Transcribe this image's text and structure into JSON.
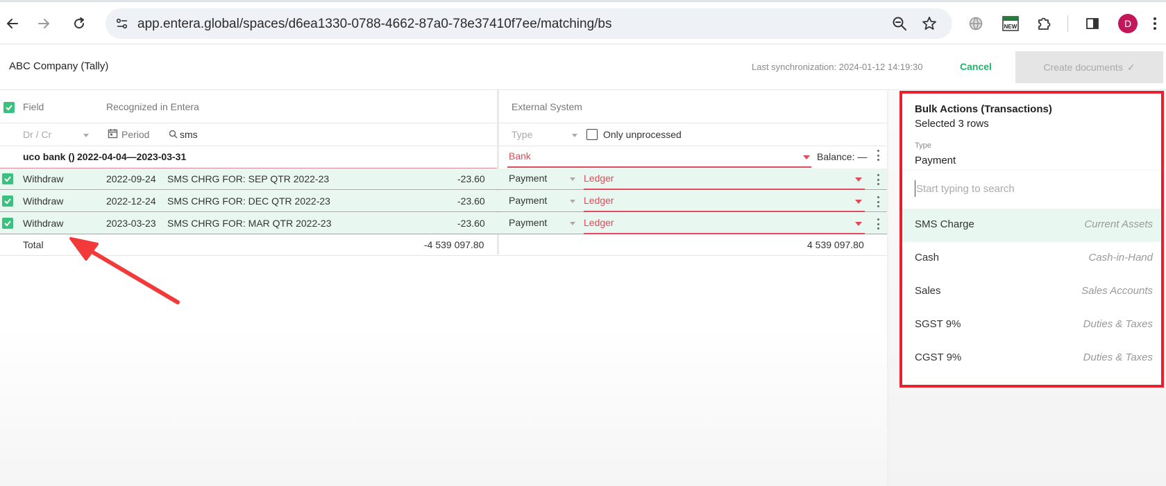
{
  "browser": {
    "url": "app.entera.global/spaces/d6ea1330-0788-4662-87a0-78e37410f7ee/matching/bs",
    "profile_initial": "D",
    "new_badge": "NEW"
  },
  "header": {
    "company": "ABC Company (Tally)",
    "last_sync": "Last synchronization: 2024-01-12 14:19:30",
    "cancel_label": "Cancel",
    "create_label": "Create documents",
    "create_check": "✓"
  },
  "table": {
    "columns": {
      "field": "Field",
      "recognized": "Recognized in Entera",
      "external": "External System"
    },
    "filters": {
      "drcr": "Dr / Cr",
      "period": "Period",
      "search_value": "sms",
      "type": "Type",
      "only_unprocessed": "Only unprocessed"
    },
    "group": {
      "title": "uco bank ()",
      "range": "2022-04-04—2023-03-31",
      "bank": "Bank",
      "balance": "Balance: —"
    },
    "rows": [
      {
        "field": "Withdraw",
        "date": "2022-09-24",
        "desc": "SMS CHRG FOR: SEP QTR 2022-23",
        "amount": "-23.60",
        "type": "Payment",
        "ledger": "Ledger"
      },
      {
        "field": "Withdraw",
        "date": "2022-12-24",
        "desc": "SMS CHRG FOR: DEC QTR 2022-23",
        "amount": "-23.60",
        "type": "Payment",
        "ledger": "Ledger"
      },
      {
        "field": "Withdraw",
        "date": "2023-03-23",
        "desc": "SMS CHRG FOR: MAR QTR 2022-23",
        "amount": "-23.60",
        "type": "Payment",
        "ledger": "Ledger"
      }
    ],
    "total": {
      "label": "Total",
      "left": "-4 539 097.80",
      "right": "4 539 097.80"
    }
  },
  "bulk_panel": {
    "title": "Bulk Actions (Transactions)",
    "selected": "Selected 3 rows",
    "type_label": "Type",
    "type_value": "Payment",
    "search_placeholder": "Start typing to search",
    "options": [
      {
        "name": "SMS Charge",
        "category": "Current Assets"
      },
      {
        "name": "Cash",
        "category": "Cash-in-Hand"
      },
      {
        "name": "Sales",
        "category": "Sales Accounts"
      },
      {
        "name": "SGST 9%",
        "category": "Duties & Taxes"
      },
      {
        "name": "CGST 9%",
        "category": "Duties & Taxes"
      }
    ]
  },
  "colors": {
    "accent_green": "#3cc07e",
    "cancel_green": "#25b26b",
    "error_red": "#e04a5a",
    "highlight_red": "#e8202e",
    "row_highlight": "#e9f7f1"
  }
}
